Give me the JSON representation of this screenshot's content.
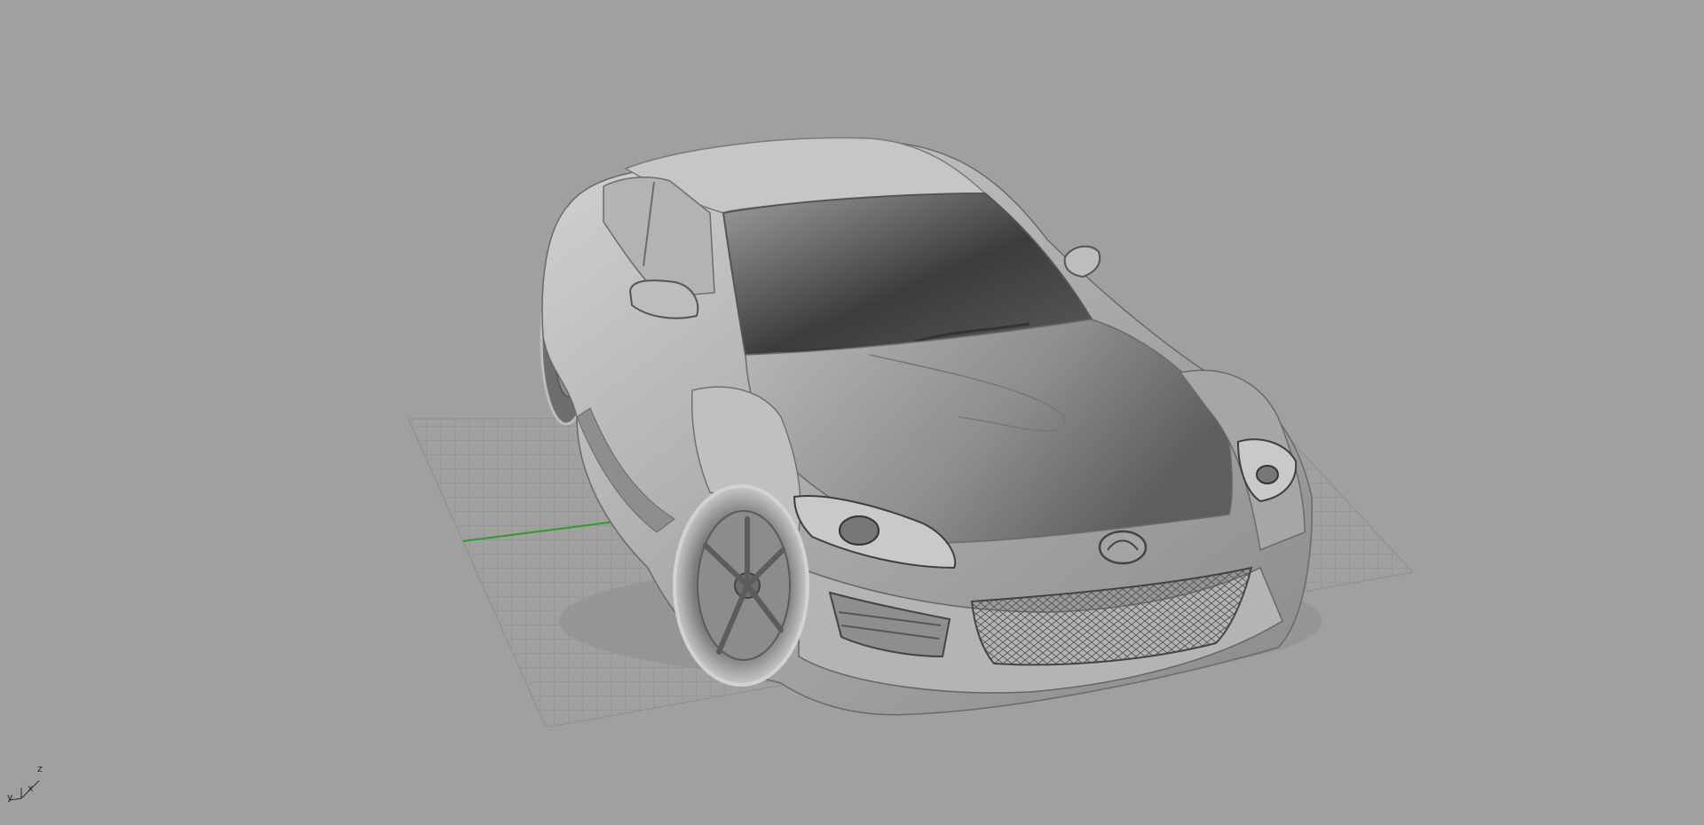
{
  "viewport": {
    "background": "#a0a0a0",
    "grid_color": "#8f8f8f",
    "grid_axis_color": "#2e9b2e"
  },
  "model": {
    "icon": "car-model"
  },
  "axis_widget": {
    "x_label": "x",
    "y_label": "y",
    "z_label": "z"
  }
}
